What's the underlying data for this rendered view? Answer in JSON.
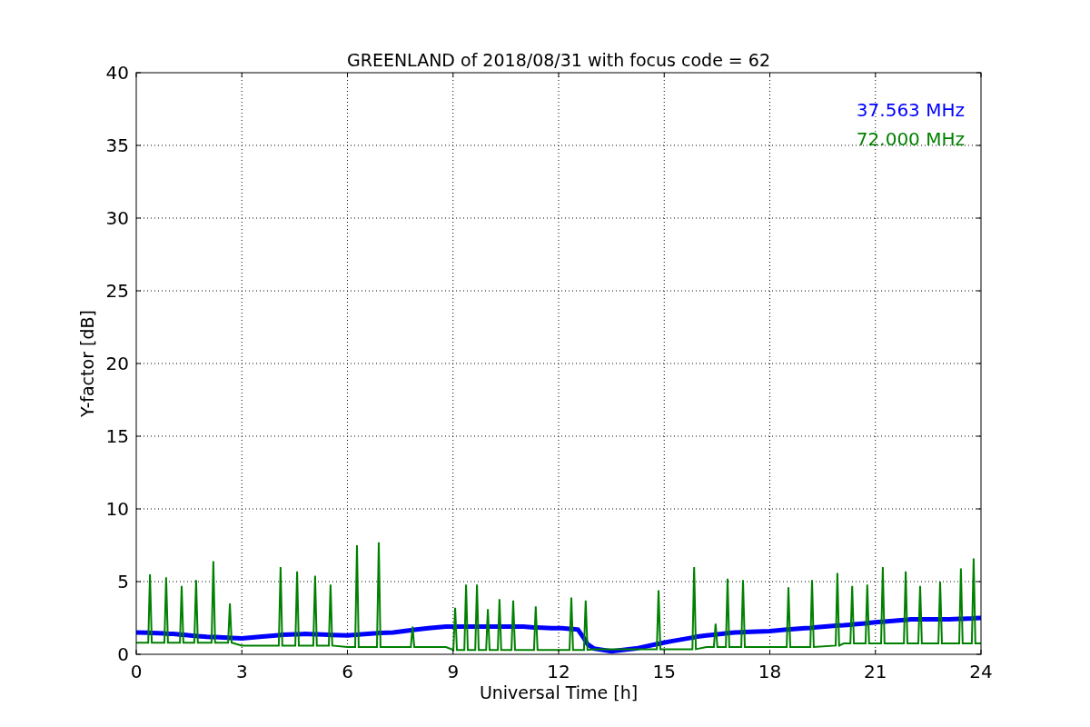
{
  "figure": {
    "chart_data": {
      "type": "line",
      "title": "GREENLAND of 2018/08/31 with focus code = 62",
      "xlabel": "Universal Time [h]",
      "ylabel": "Y-factor [dB]",
      "xlim": [
        0,
        24
      ],
      "ylim": [
        0,
        40
      ],
      "xticks": [
        0,
        3,
        6,
        9,
        12,
        15,
        18,
        21,
        24
      ],
      "yticks": [
        0,
        5,
        10,
        15,
        20,
        25,
        30,
        35,
        40
      ],
      "grid": true,
      "x": [
        0,
        0.34,
        0.39,
        0.44,
        0.8,
        0.85,
        0.9,
        1.05,
        1.24,
        1.29,
        1.34,
        1.65,
        1.7,
        1.75,
        2,
        2.14,
        2.19,
        2.24,
        2.61,
        2.66,
        2.71,
        3,
        3.5,
        4.05,
        4.1,
        4.15,
        4.52,
        4.57,
        4.62,
        4.8,
        5.03,
        5.08,
        5.13,
        5.47,
        5.52,
        5.57,
        6,
        6.22,
        6.27,
        6.32,
        6.84,
        6.89,
        6.94,
        7.3,
        7.8,
        7.85,
        7.9,
        8.3,
        8.8,
        9.01,
        9.06,
        9.11,
        9.32,
        9.37,
        9.42,
        9.63,
        9.68,
        9.73,
        9.94,
        9.99,
        10.04,
        10.15,
        10.27,
        10.32,
        10.37,
        10.66,
        10.71,
        10.76,
        11,
        11.3,
        11.35,
        11.4,
        11.8,
        12.1,
        12.31,
        12.36,
        12.41,
        12.55,
        12.72,
        12.77,
        12.82,
        13,
        13.5,
        14.2,
        14.79,
        14.84,
        14.89,
        15.2,
        15.8,
        15.85,
        15.9,
        16.2,
        16.41,
        16.46,
        16.51,
        16.75,
        16.8,
        16.85,
        17,
        17.19,
        17.24,
        17.29,
        18,
        18.48,
        18.53,
        18.58,
        19,
        19.15,
        19.2,
        19.25,
        19.87,
        19.92,
        19.97,
        20.1,
        20.29,
        20.34,
        20.39,
        20.72,
        20.77,
        20.82,
        21,
        21.16,
        21.21,
        21.26,
        21.81,
        21.86,
        21.91,
        22,
        22.22,
        22.27,
        22.32,
        22.79,
        22.84,
        22.89,
        23.1,
        23.38,
        23.43,
        23.48,
        23.74,
        23.79,
        23.84,
        24
      ],
      "series": [
        {
          "name": "37.563 MHz",
          "color": "#0000ff",
          "values": [
            1.5,
            1.48,
            1.47,
            1.47,
            1.43,
            1.42,
            1.41,
            1.4,
            1.36,
            1.35,
            1.34,
            1.27,
            1.26,
            1.25,
            1.2,
            1.19,
            1.18,
            1.18,
            1.14,
            1.13,
            1.13,
            1.1,
            1.2,
            1.32,
            1.33,
            1.34,
            1.38,
            1.38,
            1.38,
            1.4,
            1.38,
            1.37,
            1.37,
            1.34,
            1.33,
            1.33,
            1.3,
            1.34,
            1.35,
            1.36,
            1.45,
            1.46,
            1.47,
            1.5,
            1.65,
            1.67,
            1.68,
            1.8,
            1.9,
            1.9,
            1.9,
            1.9,
            1.9,
            1.9,
            1.9,
            1.9,
            1.9,
            1.9,
            1.9,
            1.9,
            1.9,
            1.9,
            1.9,
            1.9,
            1.9,
            1.9,
            1.9,
            1.9,
            1.9,
            1.85,
            1.85,
            1.85,
            1.8,
            1.8,
            1.75,
            1.74,
            1.73,
            1.7,
            1.1,
            0.9,
            0.7,
            0.4,
            0.2,
            0.4,
            0.7,
            0.72,
            0.75,
            0.9,
            1.15,
            1.17,
            1.2,
            1.3,
            1.35,
            1.36,
            1.37,
            1.44,
            1.45,
            1.46,
            1.5,
            1.52,
            1.52,
            1.53,
            1.6,
            1.7,
            1.7,
            1.71,
            1.8,
            1.82,
            1.83,
            1.84,
            1.97,
            1.98,
            1.99,
            2.0,
            2.04,
            2.05,
            2.06,
            2.13,
            2.14,
            2.15,
            2.2,
            2.23,
            2.24,
            2.25,
            2.36,
            2.37,
            2.38,
            2.4,
            2.4,
            2.4,
            2.4,
            2.4,
            2.4,
            2.4,
            2.4,
            2.43,
            2.44,
            2.44,
            2.47,
            2.48,
            2.48,
            2.5
          ]
        },
        {
          "name": "72.000 MHz",
          "color": "#008000",
          "values": [
            0.8,
            0.8,
            5.5,
            0.8,
            0.8,
            5.3,
            0.8,
            0.8,
            0.8,
            4.7,
            0.8,
            0.8,
            5.1,
            0.8,
            0.8,
            0.8,
            6.4,
            0.8,
            0.8,
            3.5,
            0.8,
            0.6,
            0.6,
            0.6,
            6.0,
            0.6,
            0.6,
            5.7,
            0.6,
            0.6,
            0.6,
            5.4,
            0.6,
            0.6,
            4.8,
            0.6,
            0.5,
            0.5,
            7.5,
            0.5,
            0.5,
            7.7,
            0.5,
            0.5,
            0.5,
            1.9,
            0.5,
            0.5,
            0.5,
            0.3,
            3.2,
            0.3,
            0.3,
            4.8,
            0.3,
            0.3,
            4.8,
            0.3,
            0.3,
            3.1,
            0.3,
            0.3,
            0.3,
            3.8,
            0.3,
            0.3,
            3.7,
            0.3,
            0.3,
            0.3,
            3.3,
            0.3,
            0.3,
            0.3,
            0.3,
            3.9,
            0.3,
            0.3,
            0.3,
            3.7,
            0.3,
            0.35,
            0.35,
            0.35,
            0.35,
            4.4,
            0.35,
            0.35,
            0.35,
            6.0,
            0.35,
            0.5,
            0.5,
            2.1,
            0.5,
            0.5,
            5.2,
            0.5,
            0.5,
            0.5,
            5.1,
            0.5,
            0.5,
            0.5,
            4.6,
            0.5,
            0.5,
            0.5,
            5.1,
            0.5,
            0.6,
            5.6,
            0.6,
            0.75,
            0.75,
            4.7,
            0.75,
            0.75,
            4.8,
            0.75,
            0.75,
            0.75,
            6.0,
            0.75,
            0.75,
            5.7,
            0.75,
            0.75,
            0.75,
            4.7,
            0.75,
            0.75,
            5.0,
            0.75,
            0.75,
            0.75,
            5.9,
            0.75,
            0.75,
            6.6,
            0.75,
            0.75
          ]
        }
      ]
    }
  }
}
